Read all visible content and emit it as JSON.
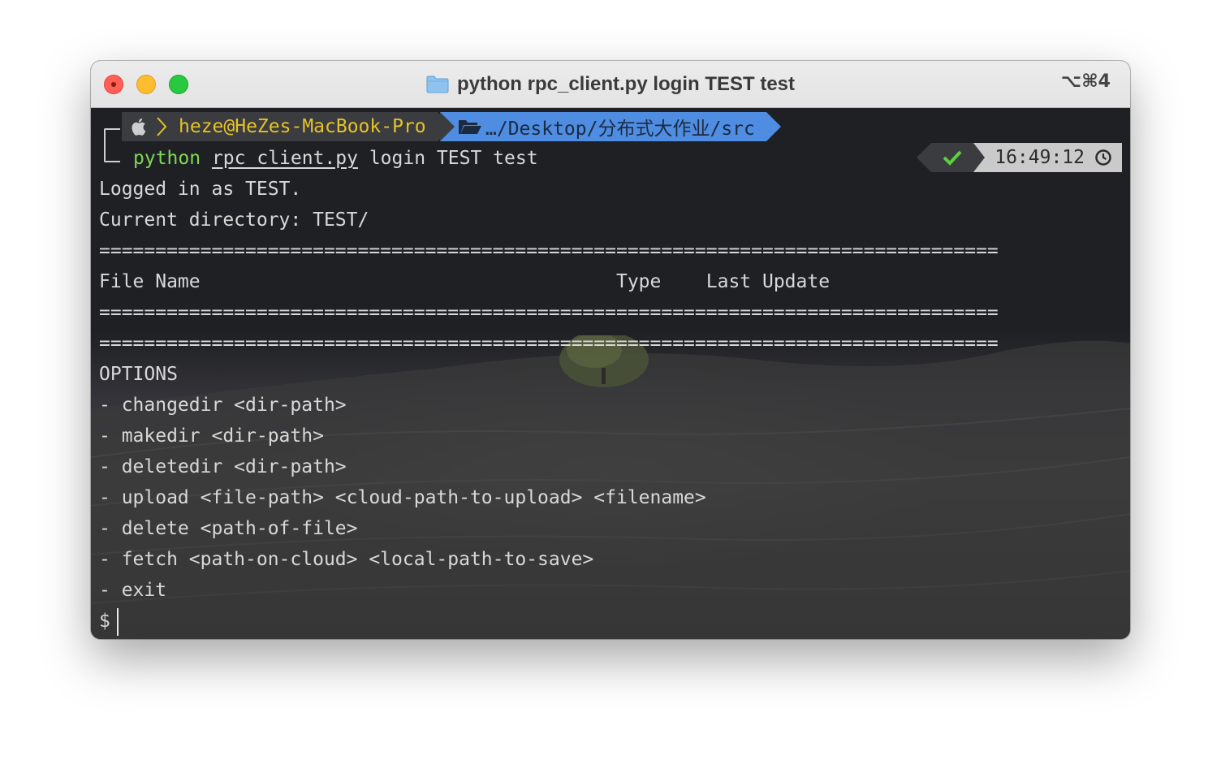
{
  "window": {
    "title": "python rpc_client.py login TEST test",
    "shortcut": "⌥⌘4"
  },
  "prompt": {
    "host": "heze@HeZes-MacBook-Pro",
    "path": "…/Desktop/分布式大作业/src",
    "command": {
      "program": "python",
      "file": "rpc_client.py",
      "args": "login TEST test"
    },
    "status_time": "16:49:12"
  },
  "output": {
    "lines": [
      "Logged in as TEST.",
      "Current directory: TEST/",
      "================================================================================",
      "File Name                                     Type    Last Update",
      "================================================================================",
      "================================================================================",
      "OPTIONS",
      "- changedir <dir-path>",
      "- makedir <dir-path>",
      "- deletedir <dir-path>",
      "- upload <file-path> <cloud-path-to-upload> <filename>",
      "- delete <path-of-file>",
      "- fetch <path-on-cloud> <local-path-to-save>",
      "- exit"
    ],
    "input_prompt": "$"
  },
  "colors": {
    "host_text": "#e6c229",
    "path_segment": "#4e8de1",
    "python_cmd": "#7ed957",
    "ok_check": "#5ad13c"
  }
}
